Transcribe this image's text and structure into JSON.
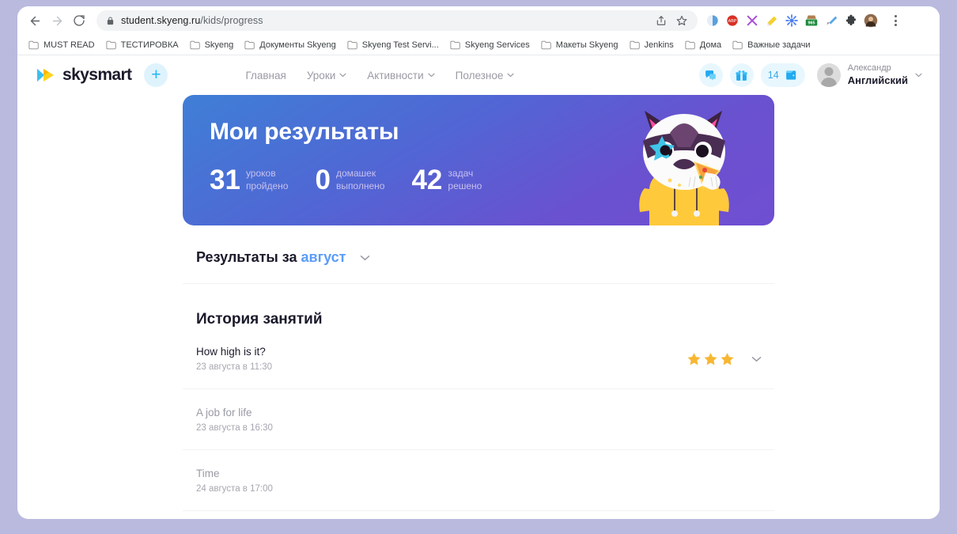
{
  "browser": {
    "back_icon": "back-arrow-icon",
    "forward_icon": "forward-arrow-icon",
    "reload_icon": "reload-icon",
    "lock_icon": "lock-icon",
    "url_domain": "student.skyeng.ru",
    "url_path": "/kids/progress",
    "share_icon": "share-icon",
    "bookmark_icon": "star-outline-icon",
    "menu_icon": "kebab-menu-icon",
    "extensions": [
      {
        "name": "extension-icon-lens",
        "color": "#4a90d9"
      },
      {
        "name": "extension-icon-adblock",
        "color": "#d93025"
      },
      {
        "name": "extension-icon-x",
        "color": "#a94fd6"
      },
      {
        "name": "extension-icon-highlighter",
        "color": "#f2c200"
      },
      {
        "name": "extension-icon-asterisk",
        "color": "#4a7ff0"
      },
      {
        "name": "extension-icon-counter",
        "color": "#1b8a3a",
        "badge": "965"
      },
      {
        "name": "extension-icon-dropper",
        "color": "#5aa7e8"
      },
      {
        "name": "extension-icon-puzzle",
        "color": "#3c4043"
      },
      {
        "name": "extension-icon-avatar",
        "color": "#b07a5a"
      }
    ],
    "bookmarks": [
      {
        "label": "MUST READ"
      },
      {
        "label": "ТЕСТИРОВКА"
      },
      {
        "label": "Skyeng"
      },
      {
        "label": "Документы Skyeng"
      },
      {
        "label": "Skyeng Test Servi..."
      },
      {
        "label": "Skyeng Services"
      },
      {
        "label": "Макеты Skyeng"
      },
      {
        "label": "Jenkins"
      },
      {
        "label": "Дома"
      },
      {
        "label": "Важные задачи"
      }
    ]
  },
  "site": {
    "logo_text": "skysmart",
    "add_button_label": "+",
    "nav": [
      {
        "label": "Главная",
        "has_chevron": false
      },
      {
        "label": "Уроки",
        "has_chevron": true
      },
      {
        "label": "Активности",
        "has_chevron": true
      },
      {
        "label": "Полезное",
        "has_chevron": true
      }
    ],
    "chat_icon": "chat-bubble-icon",
    "gift_icon": "gift-box-icon",
    "wallet_icon": "wallet-icon",
    "coins": "14",
    "profile": {
      "name": "Александр",
      "course": "Английский",
      "avatar_icon": "avatar-placeholder-icon",
      "chevron_icon": "chevron-down-icon"
    }
  },
  "hero": {
    "title": "Мои результаты",
    "accent_start": "#3f7fd6",
    "accent_end": "#6f4fd2",
    "stats": [
      {
        "value": "31",
        "line1": "уроков",
        "line2": "пройдено"
      },
      {
        "value": "0",
        "line1": "домашек",
        "line2": "выполнено"
      },
      {
        "value": "42",
        "line1": "задач",
        "line2": "решено"
      }
    ],
    "mascot_icon": "raccoon-mascot-illustration"
  },
  "results": {
    "prefix": "Результаты за",
    "month": "август",
    "chevron_icon": "chevron-down-icon"
  },
  "history": {
    "title": "История занятий",
    "lessons": [
      {
        "name": "How high is it?",
        "date": "23 августа в 11:30",
        "dim": false,
        "stars": 3,
        "chevron_icon": "chevron-down-icon"
      },
      {
        "name": "A job for life",
        "date": "23 августа в 16:30",
        "dim": true,
        "stars": 0,
        "chevron_icon": ""
      },
      {
        "name": "Time",
        "date": "24 августа в 17:00",
        "dim": true,
        "stars": 0,
        "chevron_icon": ""
      }
    ],
    "star_color": "#f7b733"
  }
}
